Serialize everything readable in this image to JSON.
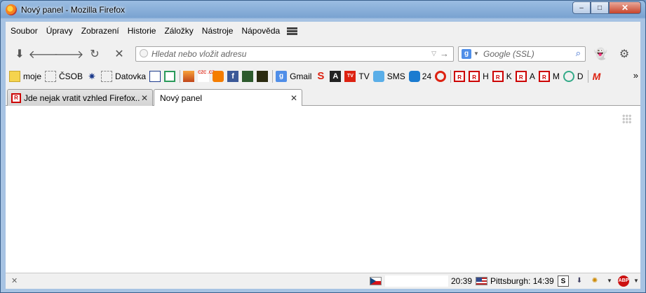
{
  "window": {
    "title": "Nový panel - Mozilla Firefox",
    "buttons": {
      "minimize": "–",
      "maximize": "□",
      "close": "✕"
    }
  },
  "menubar": [
    "Soubor",
    "Úpravy",
    "Zobrazení",
    "Historie",
    "Záložky",
    "Nástroje",
    "Nápověda"
  ],
  "navbar": {
    "url_placeholder": "Hledat nebo vložit adresu",
    "search_placeholder": "Google (SSL)",
    "search_engine_icon": "google-icon"
  },
  "bookmarks": {
    "moje": "moje",
    "csob": "ČSOB",
    "datovka": "Datovka",
    "czc": "CZC .CZ",
    "gmail": "Gmail",
    "tv": "TV",
    "sms": "SMS",
    "num24": "24",
    "h": "H",
    "k": "K",
    "a": "A",
    "m": "M",
    "d": "D",
    "more": "»"
  },
  "tabs": [
    {
      "title": "Jde nejak vratit vzhled Firefox...",
      "active": false
    },
    {
      "title": "Nový panel",
      "active": true
    }
  ],
  "statusbar": {
    "time_local": "20:39",
    "time_remote": "Pittsburgh: 14:39",
    "close_label": "✕"
  },
  "colors": {
    "title_bar": "#7aa3d1",
    "chrome_bg": "#f0f0f0",
    "rnet_red": "#cc0000"
  }
}
